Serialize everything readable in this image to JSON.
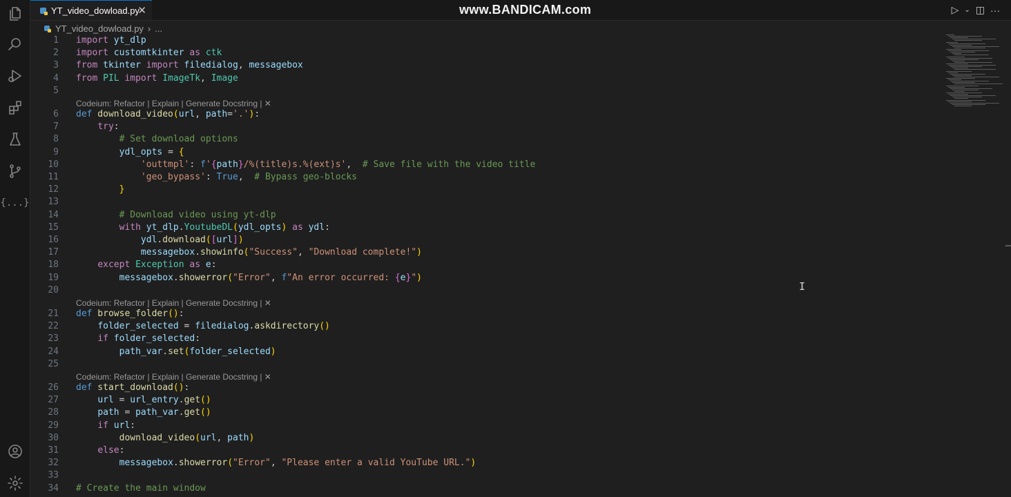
{
  "tab": {
    "filename": "YT_video_dowload.py",
    "close": "✕"
  },
  "watermark": "www.BANDICAM.com",
  "breadcrumb": {
    "file": "YT_video_dowload.py",
    "sep": "›",
    "rest": "..."
  },
  "activity": {
    "extensions_text": "{...}"
  },
  "lens_text": "Codeium: Refactor | Explain | Generate Docstring | ✕",
  "lines": [
    {
      "n": "1",
      "tokens": [
        [
          "kw",
          "import"
        ],
        [
          "",
          ""
        ],
        [
          "",
          ""
        ],
        [
          "var",
          " yt_dlp"
        ]
      ]
    },
    {
      "n": "2",
      "tokens": [
        [
          "kw",
          "import"
        ],
        [
          "var",
          " customtkinter"
        ],
        [
          "kw",
          " as"
        ],
        [
          "cls",
          " ctk"
        ]
      ]
    },
    {
      "n": "3",
      "tokens": [
        [
          "kw",
          "from"
        ],
        [
          "var",
          " tkinter"
        ],
        [
          "kw",
          " import"
        ],
        [
          "var",
          " filedialog"
        ],
        [
          "",
          ", "
        ],
        [
          "var",
          "messagebox"
        ]
      ]
    },
    {
      "n": "4",
      "tokens": [
        [
          "kw",
          "from"
        ],
        [
          "cls",
          " PIL"
        ],
        [
          "kw",
          " import"
        ],
        [
          "cls",
          " ImageTk"
        ],
        [
          "",
          ", "
        ],
        [
          "cls",
          "Image"
        ]
      ]
    },
    {
      "n": "5",
      "tokens": []
    },
    {
      "n": "6",
      "tokens": [
        [
          "kw2",
          "def"
        ],
        [
          "fn",
          " download_video"
        ],
        [
          "br1",
          "("
        ],
        [
          "var",
          "url"
        ],
        [
          "",
          ", "
        ],
        [
          "var",
          "path"
        ],
        [
          "",
          "="
        ],
        [
          "str",
          "'.'"
        ],
        [
          "br1",
          ")"
        ],
        [
          "",
          ":"
        ]
      ]
    },
    {
      "n": "7",
      "tokens": [
        [
          "",
          "    "
        ],
        [
          "kw",
          "try"
        ],
        [
          "",
          ":"
        ]
      ]
    },
    {
      "n": "8",
      "tokens": [
        [
          "",
          "        "
        ],
        [
          "cm",
          "# Set download options"
        ]
      ]
    },
    {
      "n": "9",
      "tokens": [
        [
          "",
          "        "
        ],
        [
          "var",
          "ydl_opts"
        ],
        [
          "",
          " = "
        ],
        [
          "br1",
          "{"
        ]
      ]
    },
    {
      "n": "10",
      "tokens": [
        [
          "",
          "            "
        ],
        [
          "str",
          "'outtmpl'"
        ],
        [
          "",
          ": "
        ],
        [
          "kw2",
          "f"
        ],
        [
          "str",
          "'"
        ],
        [
          "br2",
          "{"
        ],
        [
          "var",
          "path"
        ],
        [
          "br2",
          "}"
        ],
        [
          "str",
          "/%(title)s.%(ext)s'"
        ],
        [
          "",
          ",  "
        ],
        [
          "cm",
          "# Save file with the video title"
        ]
      ]
    },
    {
      "n": "11",
      "tokens": [
        [
          "",
          "            "
        ],
        [
          "str",
          "'geo_bypass'"
        ],
        [
          "",
          ": "
        ],
        [
          "kw2",
          "True"
        ],
        [
          "",
          ",  "
        ],
        [
          "cm",
          "# Bypass geo-blocks"
        ]
      ]
    },
    {
      "n": "12",
      "tokens": [
        [
          "",
          "        "
        ],
        [
          "br1",
          "}"
        ]
      ]
    },
    {
      "n": "13",
      "tokens": []
    },
    {
      "n": "14",
      "tokens": [
        [
          "",
          "        "
        ],
        [
          "cm",
          "# Download video using yt-dlp"
        ]
      ]
    },
    {
      "n": "15",
      "tokens": [
        [
          "",
          "        "
        ],
        [
          "kw",
          "with"
        ],
        [
          "var",
          " yt_dlp"
        ],
        [
          "",
          "."
        ],
        [
          "cls",
          "YoutubeDL"
        ],
        [
          "br1",
          "("
        ],
        [
          "var",
          "ydl_opts"
        ],
        [
          "br1",
          ")"
        ],
        [
          "kw",
          " as"
        ],
        [
          "var",
          " ydl"
        ],
        [
          "",
          ":"
        ]
      ]
    },
    {
      "n": "16",
      "tokens": [
        [
          "",
          "            "
        ],
        [
          "var",
          "ydl"
        ],
        [
          "",
          "."
        ],
        [
          "fn",
          "download"
        ],
        [
          "br1",
          "("
        ],
        [
          "br2",
          "["
        ],
        [
          "var",
          "url"
        ],
        [
          "br2",
          "]"
        ],
        [
          "br1",
          ")"
        ]
      ]
    },
    {
      "n": "17",
      "tokens": [
        [
          "",
          "            "
        ],
        [
          "var",
          "messagebox"
        ],
        [
          "",
          "."
        ],
        [
          "fn",
          "showinfo"
        ],
        [
          "br1",
          "("
        ],
        [
          "str",
          "\"Success\""
        ],
        [
          "",
          ", "
        ],
        [
          "str",
          "\"Download complete!\""
        ],
        [
          "br1",
          ")"
        ]
      ]
    },
    {
      "n": "18",
      "tokens": [
        [
          "",
          "    "
        ],
        [
          "kw",
          "except"
        ],
        [
          "cls",
          " Exception"
        ],
        [
          "kw",
          " as"
        ],
        [
          "var",
          " e"
        ],
        [
          "",
          ":"
        ]
      ]
    },
    {
      "n": "19",
      "tokens": [
        [
          "",
          "        "
        ],
        [
          "var",
          "messagebox"
        ],
        [
          "",
          "."
        ],
        [
          "fn",
          "showerror"
        ],
        [
          "br1",
          "("
        ],
        [
          "str",
          "\"Error\""
        ],
        [
          "",
          ", "
        ],
        [
          "kw2",
          "f"
        ],
        [
          "str",
          "\"An error occurred: "
        ],
        [
          "br2",
          "{"
        ],
        [
          "var",
          "e"
        ],
        [
          "br2",
          "}"
        ],
        [
          "str",
          "\""
        ],
        [
          "br1",
          ")"
        ]
      ]
    },
    {
      "n": "20",
      "tokens": []
    },
    {
      "n": "21",
      "tokens": [
        [
          "kw2",
          "def"
        ],
        [
          "fn",
          " browse_folder"
        ],
        [
          "br1",
          "()"
        ],
        [
          "",
          ":"
        ]
      ]
    },
    {
      "n": "22",
      "tokens": [
        [
          "",
          "    "
        ],
        [
          "var",
          "folder_selected"
        ],
        [
          "",
          " = "
        ],
        [
          "var",
          "filedialog"
        ],
        [
          "",
          "."
        ],
        [
          "fn",
          "askdirectory"
        ],
        [
          "br1",
          "()"
        ]
      ]
    },
    {
      "n": "23",
      "tokens": [
        [
          "",
          "    "
        ],
        [
          "kw",
          "if"
        ],
        [
          "var",
          " folder_selected"
        ],
        [
          "",
          ":"
        ]
      ]
    },
    {
      "n": "24",
      "tokens": [
        [
          "",
          "        "
        ],
        [
          "var",
          "path_var"
        ],
        [
          "",
          "."
        ],
        [
          "fn",
          "set"
        ],
        [
          "br1",
          "("
        ],
        [
          "var",
          "folder_selected"
        ],
        [
          "br1",
          ")"
        ]
      ]
    },
    {
      "n": "25",
      "tokens": []
    },
    {
      "n": "26",
      "tokens": [
        [
          "kw2",
          "def"
        ],
        [
          "fn",
          " start_download"
        ],
        [
          "br1",
          "()"
        ],
        [
          "",
          ":"
        ]
      ]
    },
    {
      "n": "27",
      "tokens": [
        [
          "",
          "    "
        ],
        [
          "var",
          "url"
        ],
        [
          "",
          " = "
        ],
        [
          "var",
          "url_entry"
        ],
        [
          "",
          "."
        ],
        [
          "fn",
          "get"
        ],
        [
          "br1",
          "()"
        ]
      ]
    },
    {
      "n": "28",
      "tokens": [
        [
          "",
          "    "
        ],
        [
          "var",
          "path"
        ],
        [
          "",
          " = "
        ],
        [
          "var",
          "path_var"
        ],
        [
          "",
          "."
        ],
        [
          "fn",
          "get"
        ],
        [
          "br1",
          "()"
        ]
      ]
    },
    {
      "n": "29",
      "tokens": [
        [
          "",
          "    "
        ],
        [
          "kw",
          "if"
        ],
        [
          "var",
          " url"
        ],
        [
          "",
          ":"
        ]
      ]
    },
    {
      "n": "30",
      "tokens": [
        [
          "",
          "        "
        ],
        [
          "fn",
          "download_video"
        ],
        [
          "br1",
          "("
        ],
        [
          "var",
          "url"
        ],
        [
          "",
          ", "
        ],
        [
          "var",
          "path"
        ],
        [
          "br1",
          ")"
        ]
      ]
    },
    {
      "n": "31",
      "tokens": [
        [
          "",
          "    "
        ],
        [
          "kw",
          "else"
        ],
        [
          "",
          ":"
        ]
      ]
    },
    {
      "n": "32",
      "tokens": [
        [
          "",
          "        "
        ],
        [
          "var",
          "messagebox"
        ],
        [
          "",
          "."
        ],
        [
          "fn",
          "showerror"
        ],
        [
          "br1",
          "("
        ],
        [
          "str",
          "\"Error\""
        ],
        [
          "",
          ", "
        ],
        [
          "str",
          "\"Please enter a valid YouTube URL.\""
        ],
        [
          "br1",
          ")"
        ]
      ]
    },
    {
      "n": "33",
      "tokens": []
    },
    {
      "n": "34",
      "tokens": [
        [
          "cm",
          "# Create the main window"
        ]
      ]
    }
  ]
}
